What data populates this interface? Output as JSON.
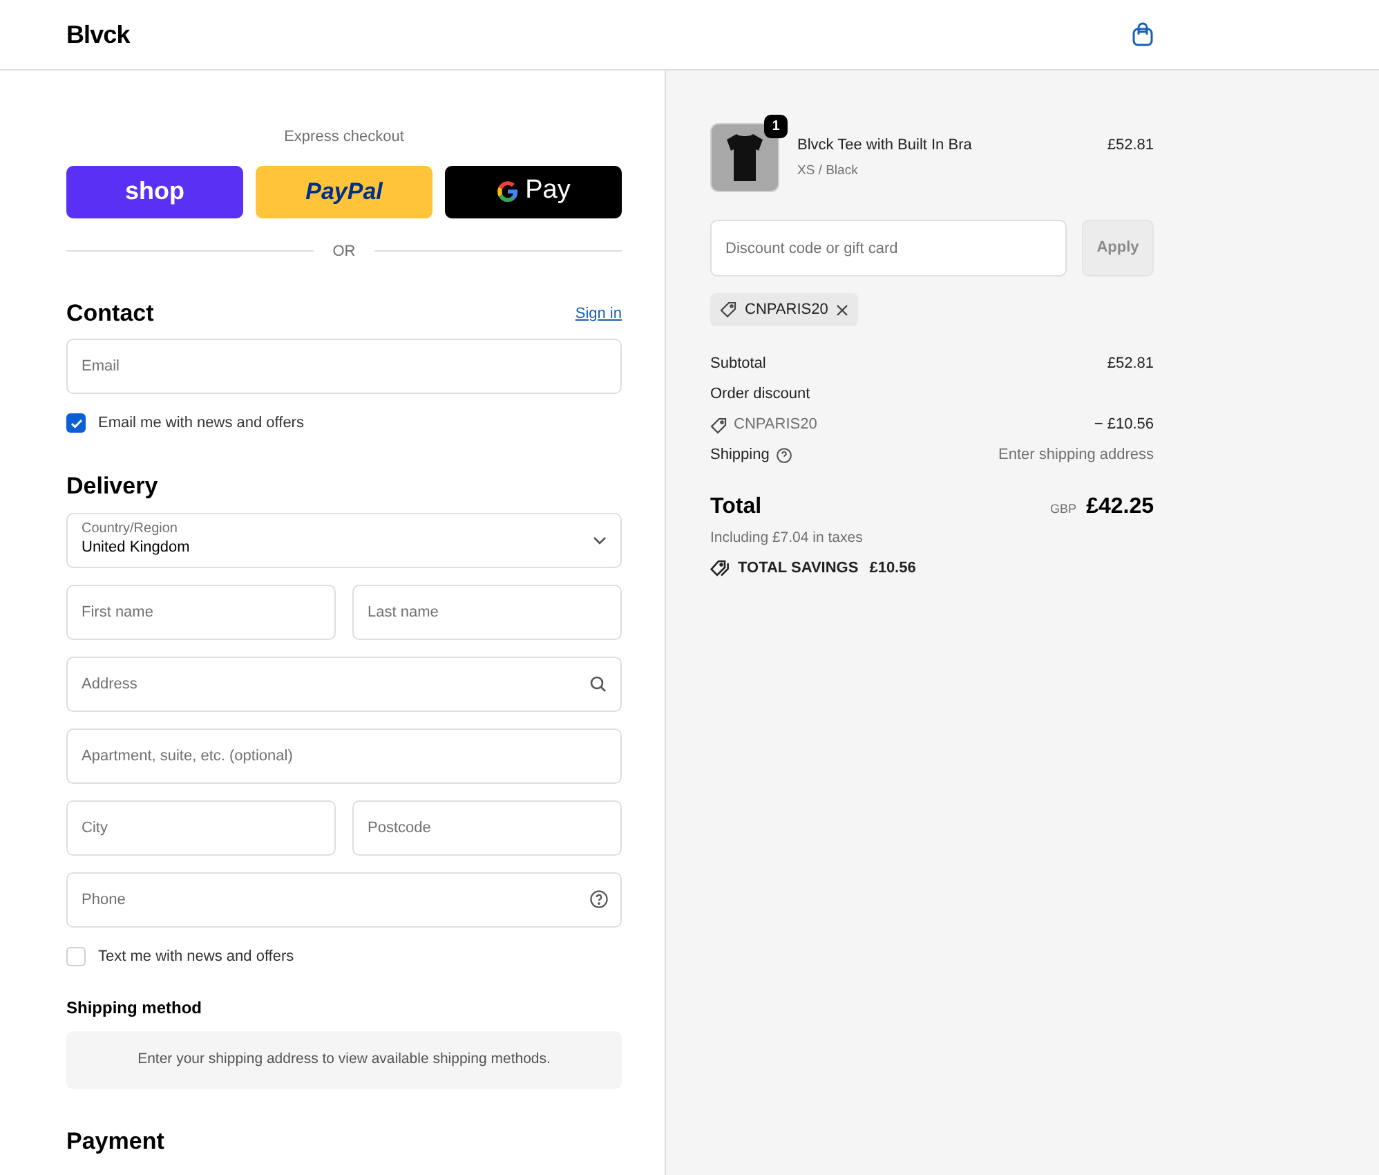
{
  "header": {
    "brand": "Blvck"
  },
  "express": {
    "title": "Express checkout",
    "buttons": [
      {
        "kind": "shop",
        "label": "shop"
      },
      {
        "kind": "paypal",
        "label": "PayPal"
      },
      {
        "kind": "gpay",
        "label": "Pay"
      }
    ],
    "divider": "OR"
  },
  "contact": {
    "title": "Contact",
    "link": "Sign in",
    "email": {
      "placeholder": "Email"
    },
    "newsletter": {
      "label": "Email me with news and offers",
      "checked": true
    }
  },
  "delivery": {
    "title": "Delivery",
    "rows": [
      [
        {
          "kind": "select",
          "label": "Country/Region",
          "value": "United Kingdom"
        }
      ],
      [
        {
          "kind": "text",
          "placeholder": "First name"
        },
        {
          "kind": "text",
          "placeholder": "Last name"
        }
      ],
      [
        {
          "kind": "search",
          "placeholder": "Address"
        }
      ],
      [
        {
          "kind": "text",
          "placeholder": "Apartment, suite, etc. (optional)"
        }
      ],
      [
        {
          "kind": "text",
          "placeholder": "City"
        },
        {
          "kind": "text",
          "placeholder": "Postcode"
        }
      ],
      [
        {
          "kind": "help",
          "placeholder": "Phone"
        }
      ]
    ],
    "sms": {
      "label": "Text me with news and offers",
      "checked": false
    }
  },
  "shipping_method": {
    "title": "Shipping method",
    "message": "Enter your shipping address to view available shipping methods."
  },
  "payment": {
    "title": "Payment"
  },
  "summary": {
    "item": {
      "name": "Blvck Tee with Built In Bra",
      "variant": "XS / Black",
      "price": "£52.81",
      "quantity": "1"
    },
    "discount": {
      "placeholder": "Discount code or gift card",
      "button": "Apply",
      "code": "CNPARIS20"
    },
    "lines": [
      {
        "kind": "plain",
        "label": "Subtotal",
        "value": "£52.81"
      },
      {
        "kind": "heading",
        "label": "Order discount"
      },
      {
        "kind": "code",
        "label": "CNPARIS20",
        "value": "− £10.56"
      },
      {
        "kind": "help",
        "label": "Shipping",
        "value": "Enter shipping address"
      }
    ],
    "total": {
      "label": "Total",
      "currency": "GBP",
      "value": "£42.25",
      "taxes": "Including £7.04 in taxes",
      "savings_label": "TOTAL SAVINGS",
      "savings_value": "£10.56"
    }
  }
}
